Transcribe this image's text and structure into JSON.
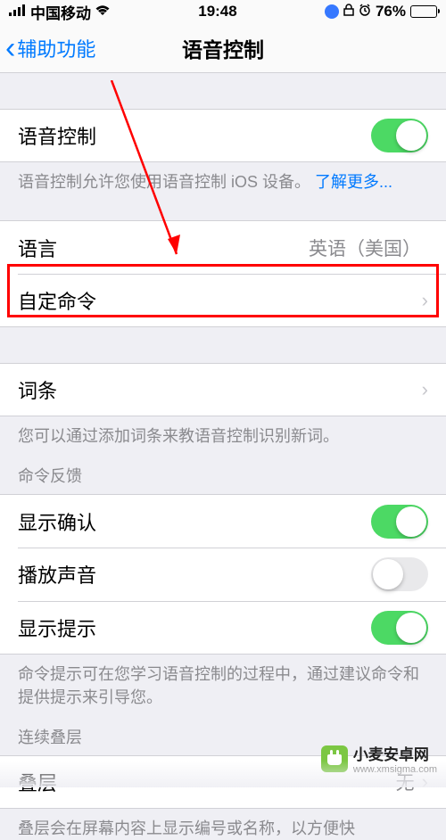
{
  "status": {
    "carrier": "中国移动",
    "time": "19:48",
    "battery_pct": "76%"
  },
  "nav": {
    "back_label": "辅助功能",
    "title": "语音控制"
  },
  "main_toggle": {
    "label": "语音控制",
    "footer_prefix": "语音控制允许您使用语音控制 iOS 设备。",
    "learn_more": "了解更多..."
  },
  "language": {
    "label": "语言",
    "value": "英语（美国）"
  },
  "custom_commands": {
    "label": "自定命令"
  },
  "vocabulary": {
    "label": "词条",
    "footer": "您可以通过添加词条来教语音控制识别新词。"
  },
  "feedback": {
    "header": "命令反馈",
    "show_confirm": "显示确认",
    "play_sound": "播放声音",
    "show_hints": "显示提示",
    "footer": "命令提示可在您学习语音控制的过程中，通过建议命令和提供提示来引导您。"
  },
  "overlay": {
    "header": "连续叠层",
    "label": "叠层",
    "value": "无",
    "footer": "叠层会在屏幕内容上显示编号或名称，以方便快"
  },
  "toggles": {
    "voice_control": true,
    "show_confirm": true,
    "play_sound": false,
    "show_hints": true
  },
  "watermark": {
    "name": "小麦安卓网",
    "url": "www.xmsigma.com"
  }
}
